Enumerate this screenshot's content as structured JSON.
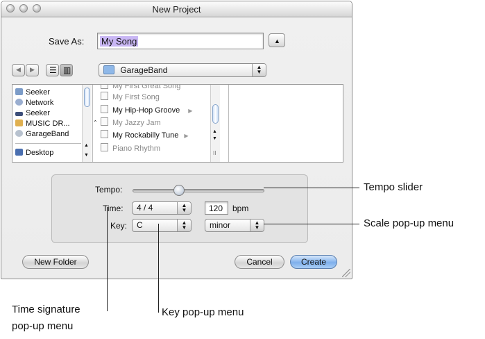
{
  "window": {
    "title": "New Project"
  },
  "save_as": {
    "label": "Save As:",
    "value": "My Song"
  },
  "location": {
    "selected": "GarageBand"
  },
  "sidebar": {
    "items": [
      {
        "label": "Seeker",
        "icon": "computer-icon"
      },
      {
        "label": "Network",
        "icon": "network-icon"
      },
      {
        "label": "Seeker",
        "icon": "drive-icon"
      },
      {
        "label": "MUSIC DR...",
        "icon": "drive-icon"
      },
      {
        "label": "GarageBand",
        "icon": "disk-icon"
      },
      {
        "label": "Desktop",
        "icon": "desktop-icon"
      }
    ]
  },
  "files": {
    "items": [
      {
        "label": "My First Great Song",
        "enabled": false
      },
      {
        "label": "My First Song",
        "enabled": false
      },
      {
        "label": "My Hip-Hop Groove",
        "enabled": true,
        "folder": true
      },
      {
        "label": "My Jazzy Jam",
        "enabled": false
      },
      {
        "label": "My Rockabilly Tune",
        "enabled": true,
        "folder": true
      },
      {
        "label": "Piano Rhythm",
        "enabled": false
      }
    ]
  },
  "tempo": {
    "label": "Tempo:",
    "value": "120",
    "unit": "bpm"
  },
  "time": {
    "label": "Time:",
    "value": "4 / 4"
  },
  "key": {
    "label": "Key:",
    "value": "C",
    "scale": "minor"
  },
  "buttons": {
    "new_folder": "New Folder",
    "cancel": "Cancel",
    "create": "Create"
  },
  "callouts": {
    "tempo_slider": "Tempo slider",
    "scale_popup": "Scale pop-up menu",
    "time_sig_1": "Time signature",
    "time_sig_2": "pop-up menu",
    "key_popup": "Key pop-up menu"
  },
  "colors": {
    "accent": "#7fb0ec",
    "selection": "#c9b7f4"
  }
}
